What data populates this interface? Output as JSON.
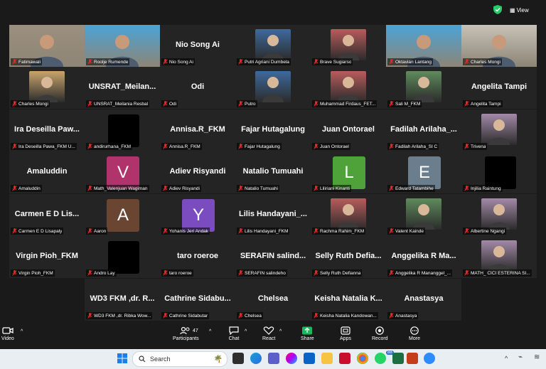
{
  "topbar": {
    "view_label": "View"
  },
  "tiles": [
    {
      "display": "video",
      "label": "Fatimawali"
    },
    {
      "display": "video",
      "label": "Roolje Rumende",
      "active": true
    },
    {
      "display": "name",
      "name": "Nio Song Ai",
      "label": "Nio Song Ai"
    },
    {
      "display": "photo",
      "label": "Putri Agriani Dumbela"
    },
    {
      "display": "photo",
      "label": "Brave Sugiarso"
    },
    {
      "display": "video",
      "label": "Oktavian Lantang"
    },
    {
      "display": "video",
      "label": "Charles Mongi"
    },
    {
      "display": "photo",
      "label": "Charles Mongi"
    },
    {
      "display": "name",
      "name": "UNSRAT_Meilan...",
      "label": "UNSRAT_Meilania Resbal"
    },
    {
      "display": "name",
      "name": "Odi",
      "label": "Odi"
    },
    {
      "display": "photo",
      "label": "Putro"
    },
    {
      "display": "photo",
      "label": "Muhammad Firdaus_FET..."
    },
    {
      "display": "photo",
      "label": "Sali M_FKM"
    },
    {
      "display": "name",
      "name": "Angelita Tampi",
      "label": "Angelita Tampi"
    },
    {
      "display": "name",
      "name": "Ira Deseilla Paw...",
      "label": "Ira Deseilla Pawa_FKM U..."
    },
    {
      "display": "black",
      "label": "andirurhana_FKM"
    },
    {
      "display": "name",
      "name": "Annisa.R_FKM",
      "label": "Annisa.R_FKM"
    },
    {
      "display": "name",
      "name": "Fajar Hutagalung",
      "label": "Fajar Hutagalung"
    },
    {
      "display": "name",
      "name": "Juan Ontorael",
      "label": "Juan Ontorael"
    },
    {
      "display": "name",
      "name": "Fadilah Arilaha_...",
      "label": "Fadilah Arilaha_SI C"
    },
    {
      "display": "photo",
      "label": "Trivena"
    },
    {
      "display": "name",
      "name": "Amaluddin",
      "label": "Amaluddin"
    },
    {
      "display": "letter",
      "letter": "V",
      "label": "Math_Valenjuan Wagiman"
    },
    {
      "display": "name",
      "name": "Adiev Risyandi",
      "label": "Adiev Risyandi"
    },
    {
      "display": "name",
      "name": "Natalio Tumuahi",
      "label": "Natalio Tumuahi"
    },
    {
      "display": "letter",
      "letter": "L",
      "label": "Liliriani Kinanti"
    },
    {
      "display": "letter",
      "letter": "E",
      "label": "Edward Tatambihe"
    },
    {
      "display": "black",
      "label": "Injilia Raintung"
    },
    {
      "display": "name",
      "name": "Carmen E D Lis...",
      "label": "Carmen E D Lisapaly"
    },
    {
      "display": "letter",
      "letter": "A",
      "label": "Aaron"
    },
    {
      "display": "letter",
      "letter": "Y",
      "label": "Yohanis Jeri Andak"
    },
    {
      "display": "name",
      "name": "Lilis Handayani_...",
      "label": "Lilis Handayani_FKM"
    },
    {
      "display": "photo",
      "label": "Rachma Rahim_FKM"
    },
    {
      "display": "photo",
      "label": "Valent Kainde"
    },
    {
      "display": "photo",
      "label": "Albertine Ngangi"
    },
    {
      "display": "name",
      "name": "Virgin Pioh_FKM",
      "label": "Virgin Pioh_FKM"
    },
    {
      "display": "black",
      "label": "Andro Lay"
    },
    {
      "display": "name",
      "name": "taro roeroe",
      "label": "taro roeroe"
    },
    {
      "display": "name",
      "name": "SERAFIN salind...",
      "label": "SERAFIN salindeho"
    },
    {
      "display": "name",
      "name": "Selly Ruth Defia...",
      "label": "Selly Ruth Defianna"
    },
    {
      "display": "name",
      "name": "Anggelika R Ma...",
      "label": "Anggelika R Mananggel_..."
    },
    {
      "display": "photo",
      "label": "MATH_ CICI ESTERINA SI..."
    },
    {
      "display": "name",
      "name": "WD3 FKM ,dr. R...",
      "label": "WD3 FKM ,dr. Ribka Wow..."
    },
    {
      "display": "name",
      "name": "Cathrine Sidabu...",
      "label": "Cathrine Sidabutar"
    },
    {
      "display": "name",
      "name": "Chelsea",
      "label": "Chelsea"
    },
    {
      "display": "name",
      "name": "Keisha Natalia K...",
      "label": "Keisha Natalia Kandowan..."
    },
    {
      "display": "name",
      "name": "Anastasya",
      "label": "Anastasya"
    }
  ],
  "toolbar": {
    "video_label": "Video",
    "participants_label": "Participants",
    "participants_count": "47",
    "chat_label": "Chat",
    "react_label": "React",
    "share_label": "Share",
    "apps_label": "Apps",
    "record_label": "Record",
    "more_label": "More"
  },
  "taskbar": {
    "search_placeholder": "Search",
    "badge_count": "88"
  },
  "colors": {
    "tile_bg": "#242424",
    "active_border": "#2ac96b",
    "muted_mic": "#e02828",
    "letter_V": "#b0336b",
    "letter_L": "#4fa23a",
    "letter_E": "#6a7e8e",
    "letter_A": "#6a4632",
    "letter_Y": "#7a4cc0",
    "share_green": "#19b85a"
  }
}
